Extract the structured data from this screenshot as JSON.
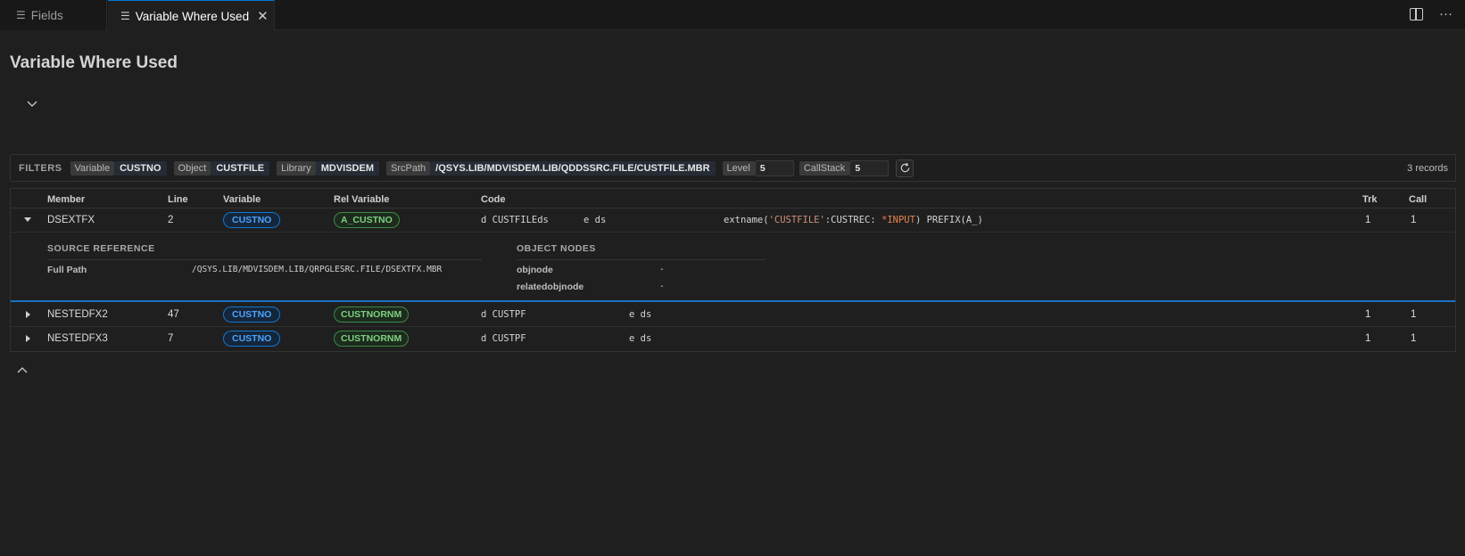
{
  "tabs": [
    {
      "label": "Fields",
      "icon": "list-icon"
    },
    {
      "label": "Variable Where Used",
      "icon": "list-icon",
      "active": true
    }
  ],
  "page_title": "Variable Where Used",
  "filters": {
    "label": "FILTERS",
    "variable_k": "Variable",
    "variable_v": "CUSTNO",
    "object_k": "Object",
    "object_v": "CUSTFILE",
    "library_k": "Library",
    "library_v": "MDVISDEM",
    "srcpath_k": "SrcPath",
    "srcpath_v": "/QSYS.LIB/MDVISDEM.LIB/QDDSSRC.FILE/CUSTFILE.MBR",
    "level_k": "Level",
    "level_v": "5",
    "callstack_k": "CallStack",
    "callstack_v": "5",
    "records": "3 records"
  },
  "columns": [
    "Member",
    "Line",
    "Variable",
    "Rel Variable",
    "Code",
    "Trk",
    "Call"
  ],
  "rows": [
    {
      "member": "DSEXTFX",
      "line": "2",
      "variable": "CUSTNO",
      "rel": "A_CUSTNO",
      "code_a": "d CUSTFILEds",
      "code_b": "e ds",
      "code_c1": "extname(",
      "code_c2": "'CUSTFILE'",
      "code_c3": ":CUSTREC: ",
      "code_c4": "*INPUT",
      "code_c5": ") PREFIX(A_)",
      "trk": "1",
      "call": "1",
      "expanded": true
    },
    {
      "member": "NESTEDFX2",
      "line": "47",
      "variable": "CUSTNO",
      "rel": "CUSTNORNM",
      "code_a": "d CUSTPF",
      "code_b": "e ds",
      "trk": "1",
      "call": "1"
    },
    {
      "member": "NESTEDFX3",
      "line": "7",
      "variable": "CUSTNO",
      "rel": "CUSTNORNM",
      "code_a": "d CUSTPF",
      "code_b": "e ds",
      "trk": "1",
      "call": "1"
    }
  ],
  "detail": {
    "source_title": "SOURCE REFERENCE",
    "full_path_label": "Full Path",
    "full_path_value": "/QSYS.LIB/MDVISDEM.LIB/QRPGLESRC.FILE/DSEXTFX.MBR",
    "nodes_title": "OBJECT NODES",
    "objnode_label": "objnode",
    "objnode_value": "-",
    "relatedobjnode_label": "relatedobjnode",
    "relatedobjnode_value": "-"
  },
  "colors": {
    "accent": "#0078d4",
    "variable_pill": "#4aa3ff",
    "rel_pill": "#7fd081"
  }
}
